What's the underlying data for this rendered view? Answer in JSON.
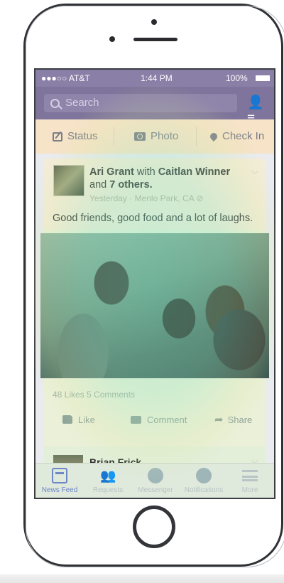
{
  "status_bar": {
    "carrier": "●●●○○ AT&T",
    "time": "1:44 PM",
    "battery": "100%"
  },
  "search": {
    "placeholder": "Search"
  },
  "composer": {
    "status": "Status",
    "photo": "Photo",
    "checkin": "Check In"
  },
  "post": {
    "author": "Ari Grant",
    "with_text": "with",
    "tagged": "Caitlan Winner",
    "and_text": "and",
    "others": "7 others.",
    "meta": "Yesterday · Menlo Park, CA",
    "text": "Good friends, good food and a lot of laughs.",
    "counts": "48 Likes 5 Comments",
    "actions": {
      "like": "Like",
      "comment": "Comment",
      "share": "Share"
    }
  },
  "next_post": {
    "author": "Brian Frick"
  },
  "tabbar": {
    "items": [
      {
        "label": "News Feed",
        "icon": "news-feed-icon"
      },
      {
        "label": "Requests",
        "icon": "requests-icon"
      },
      {
        "label": "Messenger",
        "icon": "messenger-icon"
      },
      {
        "label": "Notifications",
        "icon": "notifications-icon"
      },
      {
        "label": "More",
        "icon": "more-icon"
      }
    ]
  },
  "colors": {
    "accent": "#6d87c7",
    "header": "#7f749b"
  }
}
